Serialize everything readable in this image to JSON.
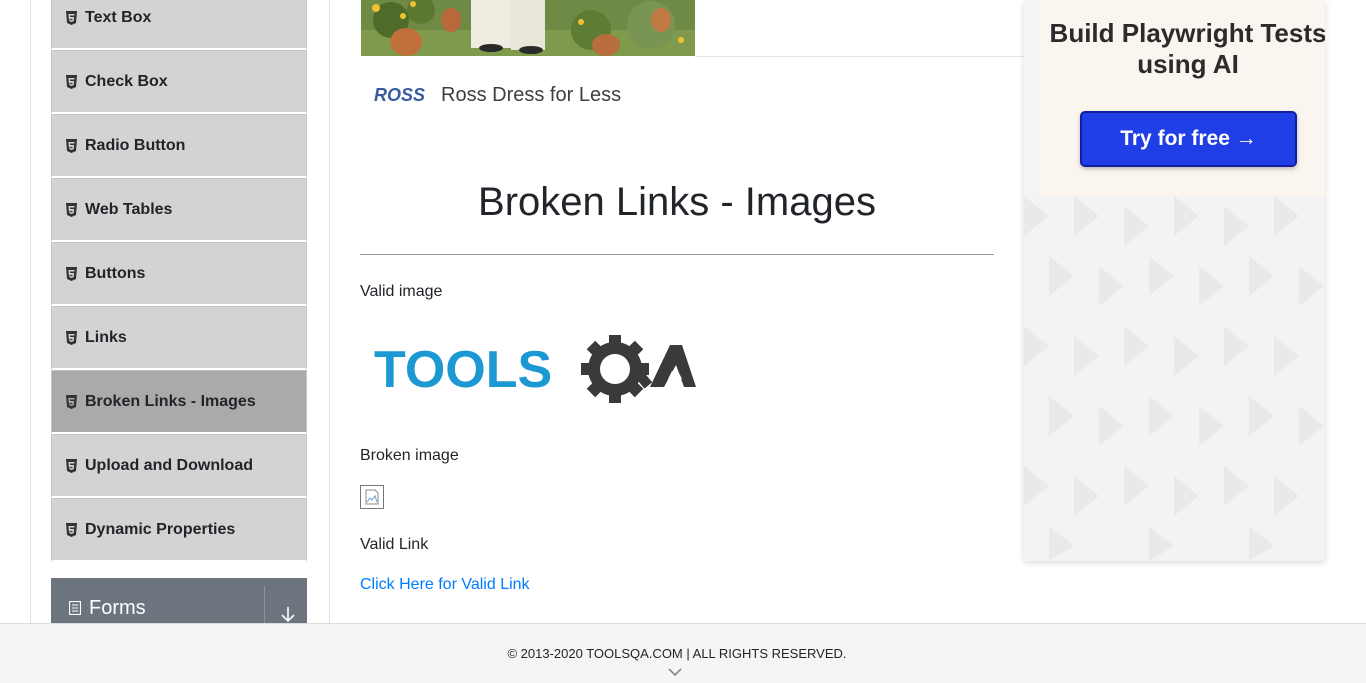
{
  "sidebar": {
    "items": [
      {
        "label": "Text Box",
        "icon": "html5-icon"
      },
      {
        "label": "Check Box",
        "icon": "html5-icon"
      },
      {
        "label": "Radio Button",
        "icon": "html5-icon"
      },
      {
        "label": "Web Tables",
        "icon": "html5-icon"
      },
      {
        "label": "Buttons",
        "icon": "html5-icon"
      },
      {
        "label": "Links",
        "icon": "html5-icon"
      },
      {
        "label": "Broken Links - Images",
        "icon": "html5-icon",
        "active": true
      },
      {
        "label": "Upload and Download",
        "icon": "html5-icon"
      },
      {
        "label": "Dynamic Properties",
        "icon": "html5-icon"
      }
    ],
    "group": {
      "label": "Forms",
      "icon": "document-icon",
      "toggle_icon": "arrow-down-icon"
    }
  },
  "ad_top": {
    "brand_logo": "ROSS",
    "brand_name": "Ross Dress for Less"
  },
  "main": {
    "title": "Broken Links - Images",
    "valid_image_label": "Valid image",
    "valid_image_logo_text": "TOOLSQA",
    "broken_image_label": "Broken image",
    "valid_link_label": "Valid Link",
    "valid_link_text": "Click Here for Valid Link"
  },
  "ad_right": {
    "title": "Build Playwright Tests using AI",
    "button_label": "Try for free →"
  },
  "footer": {
    "text": "© 2013-2020 TOOLSQA.COM | ALL RIGHTS RESERVED."
  },
  "colors": {
    "menu_bg": "#d3d3d3",
    "menu_active_bg": "#aaaaaa",
    "group_bg": "#6c757d",
    "link": "#007bff",
    "ad_button": "#1f3ee6",
    "toolsqa_blue": "#1c98d2"
  }
}
